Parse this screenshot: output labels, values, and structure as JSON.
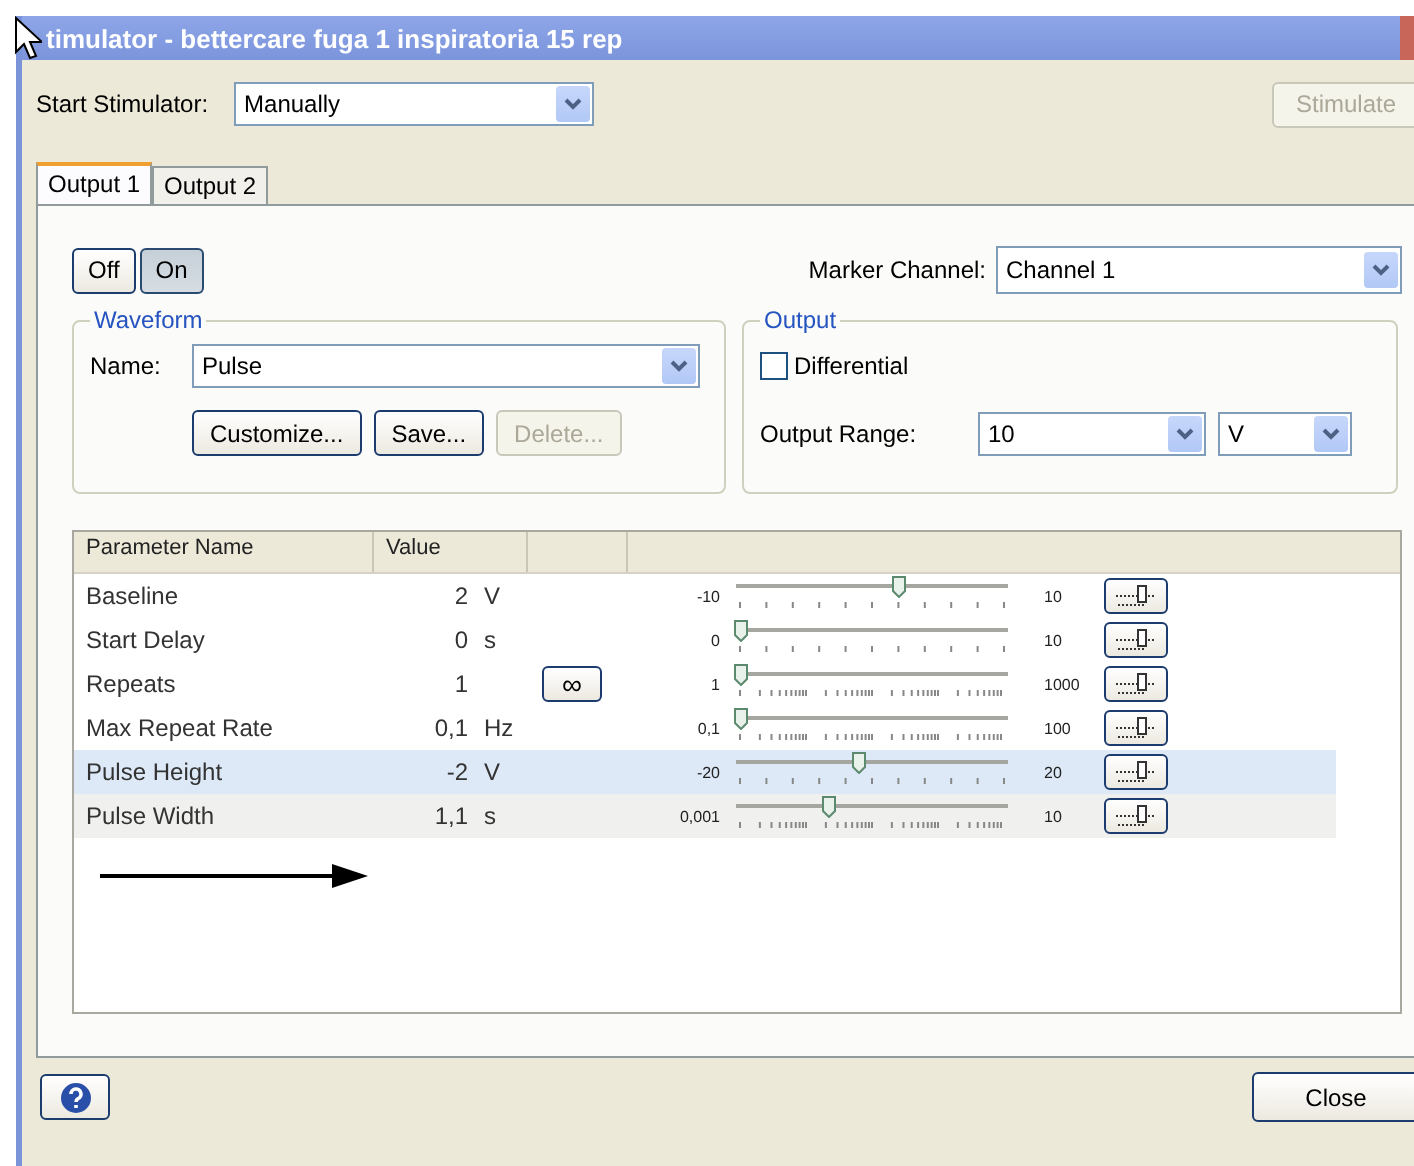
{
  "window": {
    "title": "timulator - bettercare fuga 1 inspiratoria 15 rep"
  },
  "start_stimulator": {
    "label": "Start Stimulator:",
    "value": "Manually"
  },
  "stimulate_button": {
    "label": "Stimulate",
    "disabled": true
  },
  "tabs": [
    {
      "label": "Output 1",
      "selected": true
    },
    {
      "label": "Output 2",
      "selected": false
    }
  ],
  "power": [
    {
      "label": "Off",
      "selected": false
    },
    {
      "label": "On",
      "selected": true
    }
  ],
  "marker_channel": {
    "label": "Marker Channel:",
    "value": "Channel 1"
  },
  "waveform": {
    "title": "Waveform",
    "name_label": "Name:",
    "name_value": "Pulse",
    "buttons": [
      {
        "label": "Customize...",
        "disabled": false
      },
      {
        "label": "Save...",
        "disabled": false
      },
      {
        "label": "Delete...",
        "disabled": true
      }
    ]
  },
  "output": {
    "title": "Output",
    "differential": {
      "label": "Differential",
      "checked": false
    },
    "range_label": "Output Range:",
    "range_value": "10",
    "unit_value": "V"
  },
  "table": {
    "columns": [
      "Parameter Name",
      "Value"
    ],
    "rows": [
      {
        "name": "Baseline",
        "value": "2",
        "unit": "V",
        "min": "-10",
        "max": "10",
        "level": 0.6,
        "kind": "linear",
        "selected": false,
        "hovered": false
      },
      {
        "name": "Start Delay",
        "value": "0",
        "unit": "s",
        "min": "0",
        "max": "10",
        "level": 0,
        "kind": "linear",
        "selected": false,
        "hovered": false
      },
      {
        "name": "Repeats",
        "value": "1",
        "infinity_button": "∞",
        "min": "1",
        "max": "1000",
        "level": 0,
        "kind": "log",
        "selected": false,
        "hovered": false
      },
      {
        "name": "Max Repeat Rate",
        "value": "0,1",
        "unit": "Hz",
        "min": "0,1",
        "max": "100",
        "level": 0,
        "kind": "log",
        "selected": false,
        "hovered": false
      },
      {
        "name": "Pulse Height",
        "value": "-2",
        "unit": "V",
        "min": "-20",
        "max": "20",
        "level": 0.45,
        "kind": "linear",
        "selected": true,
        "hovered": false
      },
      {
        "name": "Pulse Width",
        "value": "1,1",
        "unit": "s",
        "min": "0,001",
        "max": "10",
        "level": 0.33,
        "kind": "log",
        "selected": false,
        "hovered": true
      }
    ]
  },
  "close_button": {
    "label": "Close"
  }
}
